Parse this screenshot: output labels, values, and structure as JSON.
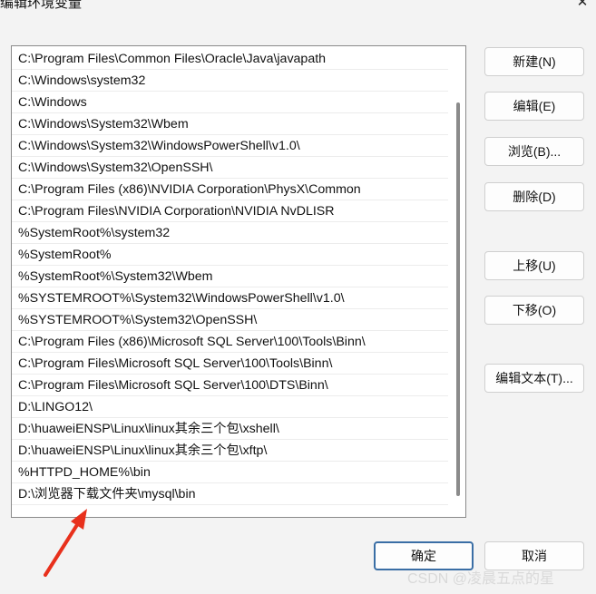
{
  "dialog": {
    "title": "编辑环境变量",
    "close_icon": "close-icon",
    "close_glyph": "✕"
  },
  "path_list": {
    "items": [
      "C:\\Program Files\\Common Files\\Oracle\\Java\\javapath",
      "C:\\Windows\\system32",
      "C:\\Windows",
      "C:\\Windows\\System32\\Wbem",
      "C:\\Windows\\System32\\WindowsPowerShell\\v1.0\\",
      "C:\\Windows\\System32\\OpenSSH\\",
      "C:\\Program Files (x86)\\NVIDIA Corporation\\PhysX\\Common",
      "C:\\Program Files\\NVIDIA Corporation\\NVIDIA NvDLISR",
      "%SystemRoot%\\system32",
      "%SystemRoot%",
      "%SystemRoot%\\System32\\Wbem",
      "%SYSTEMROOT%\\System32\\WindowsPowerShell\\v1.0\\",
      "%SYSTEMROOT%\\System32\\OpenSSH\\",
      "C:\\Program Files (x86)\\Microsoft SQL Server\\100\\Tools\\Binn\\",
      "C:\\Program Files\\Microsoft SQL Server\\100\\Tools\\Binn\\",
      "C:\\Program Files\\Microsoft SQL Server\\100\\DTS\\Binn\\",
      "D:\\LINGO12\\",
      "D:\\huaweiENSP\\Linux\\linux其余三个包\\xshell\\",
      "D:\\huaweiENSP\\Linux\\linux其余三个包\\xftp\\",
      "%HTTPD_HOME%\\bin",
      "D:\\浏览器下载文件夹\\mysql\\bin"
    ]
  },
  "buttons": {
    "new": "新建(N)",
    "edit": "编辑(E)",
    "browse": "浏览(B)...",
    "delete": "删除(D)",
    "move_up": "上移(U)",
    "move_down": "下移(O)",
    "edit_text": "编辑文本(T)...",
    "ok": "确定",
    "cancel": "取消"
  },
  "annotation": {
    "arrow_icon": "red-arrow-icon",
    "color": "#e8301c"
  },
  "watermark": "CSDN @凌晨五点的星"
}
